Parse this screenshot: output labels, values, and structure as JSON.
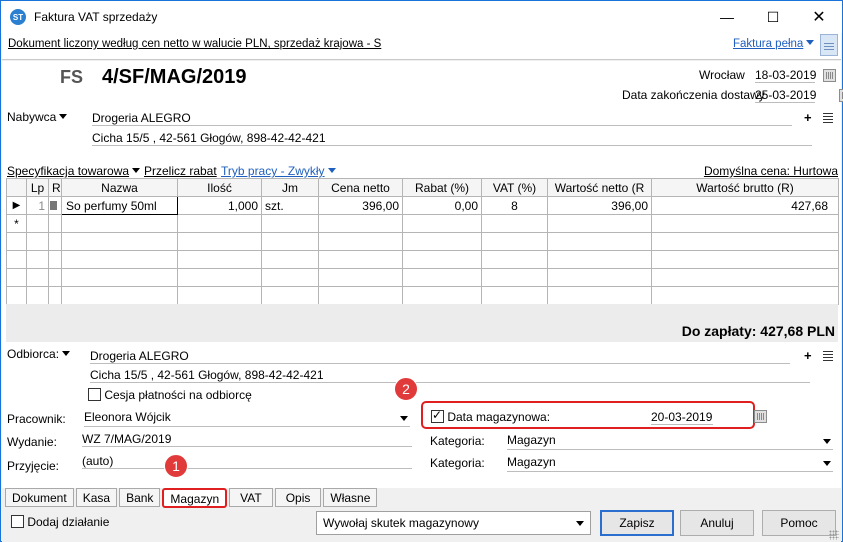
{
  "window": {
    "title": "Faktura VAT sprzedaży",
    "icon": "app-logo-icon"
  },
  "infobar": {
    "description": "Dokument liczony według cen netto w walucie PLN, sprzedaż krajowa - S",
    "full_link": "Faktura pełna"
  },
  "header": {
    "doc_type": "FS",
    "doc_number": "4/SF/MAG/2019",
    "place": "Wrocław",
    "issue_date": "18-03-2019",
    "delivery_label": "Data zakończenia dostawy",
    "delivery_date": "25-03-2019"
  },
  "buyer": {
    "label": "Nabywca",
    "name": "Drogeria ALEGRO",
    "address": "Cicha  15/5 , 42-561 Głogów, 898-42-42-421"
  },
  "spec": {
    "specification": "Specyfikacja towarowa",
    "recalc": "Przelicz rabat",
    "mode": "Tryb pracy - Zwykły",
    "default_price": "Domyślna cena: Hurtowa"
  },
  "grid": {
    "columns": [
      "Lp",
      "R",
      "Nazwa",
      "Ilość",
      "Jm",
      "Cena netto",
      "Rabat (%)",
      "VAT (%)",
      "Wartość netto (R",
      "Wartość brutto (R)"
    ],
    "row": {
      "lp": "1",
      "name": "So perfumy 50ml",
      "qty": "1,000",
      "unit": "szt.",
      "net_price": "396,00",
      "discount": "0,00",
      "vat": "8",
      "net_value": "396,00",
      "gross_value": "427,68"
    },
    "new_row_marker": "*"
  },
  "total": "Do zapłaty: 427,68 PLN",
  "recipient": {
    "label": "Odbiorca:",
    "name": "Drogeria ALEGRO",
    "address": "Cicha  15/5 , 42-561 Głogów, 898-42-42-421",
    "cession_label": "Cesja płatności na odbiorcę"
  },
  "form": {
    "employee_label": "Pracownik:",
    "employee_value": "Eleonora Wójcik",
    "storage_date_label": "Data magazynowa:",
    "storage_date_value": "20-03-2019",
    "issue_label": "Wydanie:",
    "issue_value": "WZ 7/MAG/2019",
    "receipt_label": "Przyjęcie:",
    "receipt_value": "(auto)",
    "category_label_1": "Kategoria:",
    "category_value_1": "Magazyn",
    "category_label_2": "Kategoria:",
    "category_value_2": "Magazyn"
  },
  "badges": {
    "one": "1",
    "two": "2"
  },
  "tabs": [
    "Dokument",
    "Kasa",
    "Bank",
    "Magazyn",
    "VAT",
    "Opis",
    "Własne"
  ],
  "bottom": {
    "add_action": "Dodaj działanie",
    "effect": "Wywołaj skutek magazynowy",
    "save": "Zapisz",
    "cancel": "Anuluj",
    "help": "Pomoc"
  },
  "colors": {
    "accent": "#1f5fbf",
    "highlight": "#e02020"
  }
}
